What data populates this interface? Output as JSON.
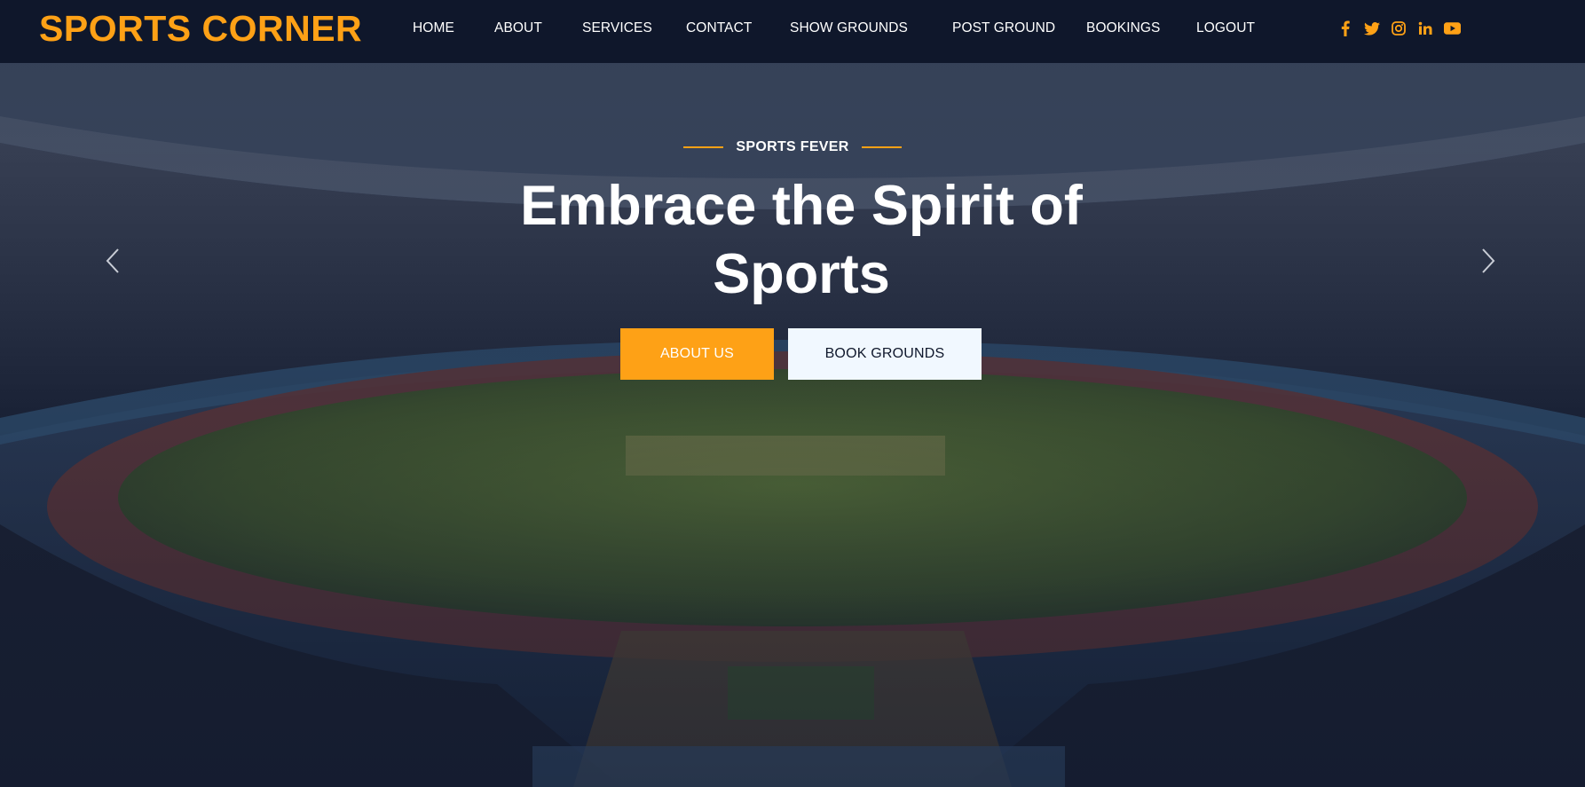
{
  "brand": {
    "name": "SPORTS CORNER",
    "color": "#fea116"
  },
  "nav": {
    "items": [
      {
        "label": "HOME"
      },
      {
        "label": "ABOUT"
      },
      {
        "label": "SERVICES"
      },
      {
        "label": "CONTACT"
      },
      {
        "label": "SHOW GROUNDS"
      },
      {
        "label": "POST GROUND"
      },
      {
        "label": "BOOKINGS"
      },
      {
        "label": "LOGOUT"
      }
    ],
    "socials": [
      "facebook-icon",
      "twitter-icon",
      "instagram-icon",
      "linkedin-icon",
      "youtube-icon"
    ]
  },
  "hero": {
    "tagline": "SPORTS FEVER",
    "headline": "Embrace the Spirit of Sports",
    "primary_button": "ABOUT US",
    "secondary_button": "BOOK GROUNDS",
    "background": "stadium-photo"
  },
  "colors": {
    "accent": "#fea116",
    "dark": "#0f172b",
    "light": "#f1f8ff"
  }
}
